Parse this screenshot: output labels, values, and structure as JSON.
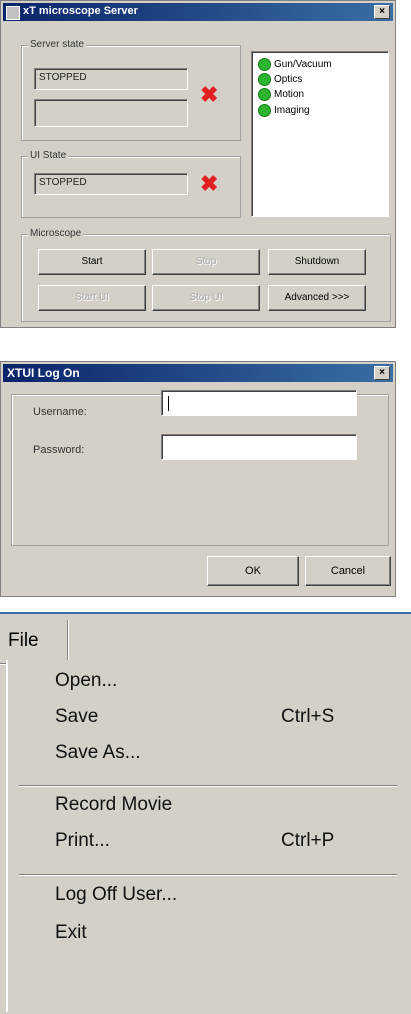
{
  "server_window": {
    "title": "xT microscope Server",
    "server_state": {
      "legend": "Server state",
      "value": "STOPPED",
      "value2": ""
    },
    "ui_state": {
      "legend": "UI State",
      "value": "STOPPED"
    },
    "status_list": [
      "Gun/Vacuum",
      "Optics",
      "Motion",
      "Imaging"
    ],
    "microscope": {
      "legend": "Microscope",
      "start": "Start",
      "stop": "Stop",
      "shutdown": "Shutdown",
      "start_ui": "Start UI",
      "stop_ui": "Stop UI",
      "advanced": "Advanced >>>"
    },
    "status_color": "#2db52d",
    "error_color": "#e02020"
  },
  "logon_window": {
    "title": "XTUI Log On",
    "username_label": "Username:",
    "password_label": "Password:",
    "username_value": "",
    "password_value": "",
    "ok": "OK",
    "cancel": "Cancel"
  },
  "file_menu": {
    "header": "File",
    "items": [
      {
        "label": "Open...",
        "shortcut": ""
      },
      {
        "label": "Save",
        "shortcut": "Ctrl+S"
      },
      {
        "label": "Save As...",
        "shortcut": ""
      },
      {
        "label": "Record Movie",
        "shortcut": ""
      },
      {
        "label": "Print...",
        "shortcut": "Ctrl+P"
      },
      {
        "label": "Log Off User...",
        "shortcut": ""
      },
      {
        "label": "Exit",
        "shortcut": ""
      }
    ]
  }
}
